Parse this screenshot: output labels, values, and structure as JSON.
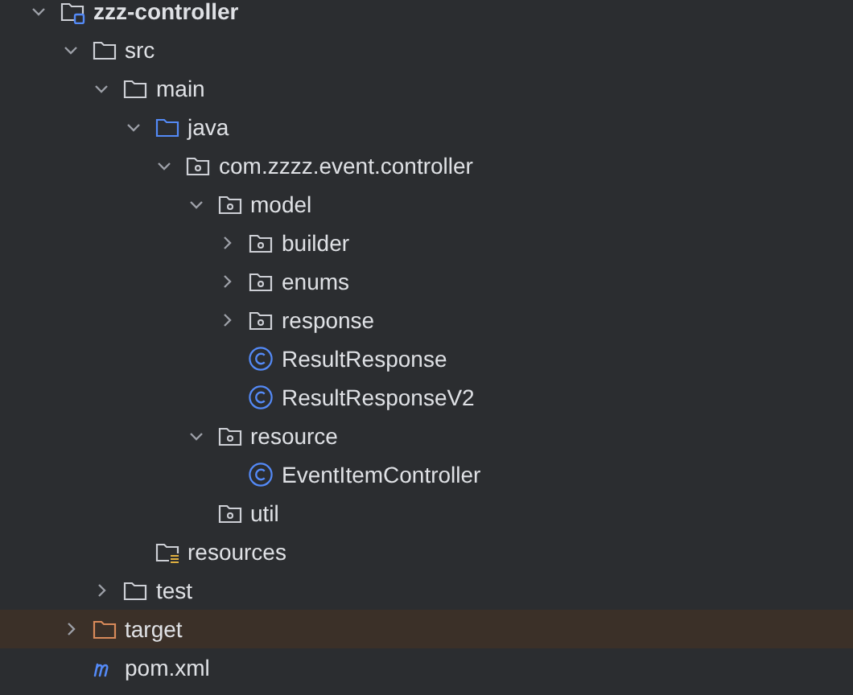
{
  "tree": [
    {
      "label": "zzz-controller",
      "kind": "module",
      "expanded": true,
      "selected": false,
      "children": [
        {
          "label": "src",
          "kind": "folder",
          "expanded": true,
          "selected": false,
          "children": [
            {
              "label": "main",
              "kind": "folder",
              "expanded": true,
              "selected": false,
              "children": [
                {
                  "label": "java",
                  "kind": "source-root",
                  "expanded": true,
                  "selected": false,
                  "children": [
                    {
                      "label": "com.zzzz.event.controller",
                      "kind": "package",
                      "expanded": true,
                      "selected": false,
                      "children": [
                        {
                          "label": "model",
                          "kind": "package",
                          "expanded": true,
                          "selected": false,
                          "children": [
                            {
                              "label": "builder",
                              "kind": "package",
                              "expanded": false,
                              "selected": false
                            },
                            {
                              "label": "enums",
                              "kind": "package",
                              "expanded": false,
                              "selected": false
                            },
                            {
                              "label": "response",
                              "kind": "package",
                              "expanded": false,
                              "selected": false
                            },
                            {
                              "label": "ResultResponse",
                              "kind": "class",
                              "selected": false
                            },
                            {
                              "label": "ResultResponseV2",
                              "kind": "class",
                              "selected": false
                            }
                          ]
                        },
                        {
                          "label": "resource",
                          "kind": "package",
                          "expanded": true,
                          "selected": false,
                          "children": [
                            {
                              "label": "EventItemController",
                              "kind": "class",
                              "selected": false
                            }
                          ]
                        },
                        {
                          "label": "util",
                          "kind": "package",
                          "selected": false
                        }
                      ]
                    }
                  ]
                },
                {
                  "label": "resources",
                  "kind": "resources-root",
                  "selected": false
                }
              ]
            },
            {
              "label": "test",
              "kind": "folder",
              "expanded": false,
              "selected": false
            }
          ]
        },
        {
          "label": "target",
          "kind": "excluded",
          "expanded": false,
          "selected": true
        },
        {
          "label": "pom.xml",
          "kind": "maven",
          "selected": false
        }
      ]
    }
  ]
}
